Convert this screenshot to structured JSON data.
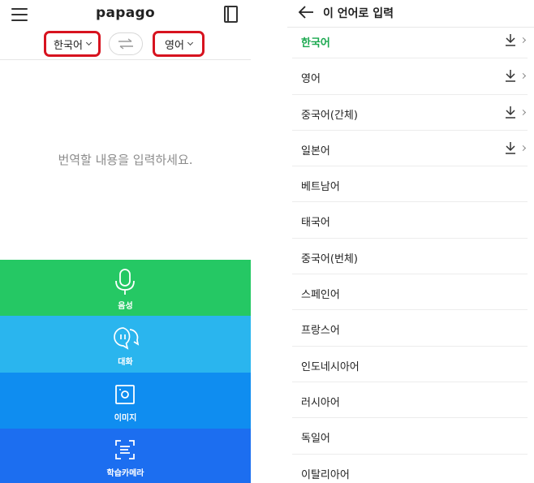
{
  "left": {
    "brand": "papago",
    "source_lang": "한국어",
    "target_lang": "영어",
    "placeholder": "번역할 내용을 입력하세요.",
    "modes": [
      {
        "label": "음성",
        "icon": "microphone-icon"
      },
      {
        "label": "대화",
        "icon": "conversation-icon"
      },
      {
        "label": "이미지",
        "icon": "image-icon"
      },
      {
        "label": "학습카메라",
        "icon": "scan-camera-icon"
      }
    ],
    "colors": {
      "voice": "#25c864",
      "conversation": "#2ab5ee",
      "image": "#0f8df0",
      "camera": "#1c6ef0",
      "highlight": "#d7131f"
    }
  },
  "right": {
    "title": "이 언어로 입력",
    "languages": [
      {
        "name": "한국어",
        "selected": true,
        "download": true
      },
      {
        "name": "영어",
        "selected": false,
        "download": true
      },
      {
        "name": "중국어(간체)",
        "selected": false,
        "download": true
      },
      {
        "name": "일본어",
        "selected": false,
        "download": true
      },
      {
        "name": "베트남어",
        "selected": false,
        "download": false
      },
      {
        "name": "태국어",
        "selected": false,
        "download": false
      },
      {
        "name": "중국어(번체)",
        "selected": false,
        "download": false
      },
      {
        "name": "스페인어",
        "selected": false,
        "download": false
      },
      {
        "name": "프랑스어",
        "selected": false,
        "download": false
      },
      {
        "name": "인도네시아어",
        "selected": false,
        "download": false
      },
      {
        "name": "러시아어",
        "selected": false,
        "download": false
      },
      {
        "name": "독일어",
        "selected": false,
        "download": false
      },
      {
        "name": "이탈리아어",
        "selected": false,
        "download": false
      }
    ],
    "selected_color": "#1aa84f"
  }
}
